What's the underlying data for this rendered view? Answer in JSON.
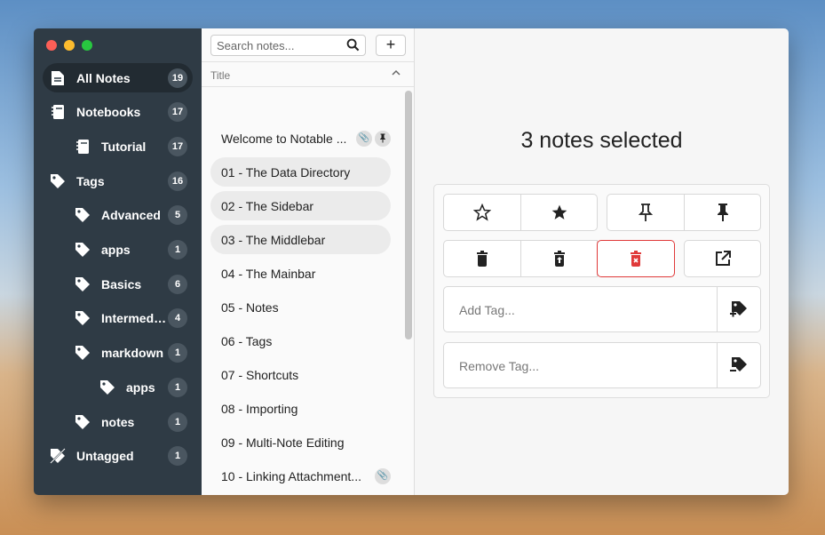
{
  "sidebar": {
    "items": [
      {
        "label": "All Notes",
        "count": "19",
        "icon": "all-notes-icon",
        "level": 0,
        "active": true
      },
      {
        "label": "Notebooks",
        "count": "17",
        "icon": "notebook-icon",
        "level": 0
      },
      {
        "label": "Tutorial",
        "count": "17",
        "icon": "notebook-icon",
        "level": 1
      },
      {
        "label": "Tags",
        "count": "16",
        "icon": "tag-icon",
        "level": 0
      },
      {
        "label": "Advanced",
        "count": "5",
        "icon": "tag-icon",
        "level": 1
      },
      {
        "label": "apps",
        "count": "1",
        "icon": "tag-icon",
        "level": 1
      },
      {
        "label": "Basics",
        "count": "6",
        "icon": "tag-icon",
        "level": 1
      },
      {
        "label": "Intermed…",
        "count": "4",
        "icon": "tag-icon",
        "level": 1
      },
      {
        "label": "markdown",
        "count": "1",
        "icon": "tag-icon",
        "level": 1
      },
      {
        "label": "apps",
        "count": "1",
        "icon": "tag-icon",
        "level": 2
      },
      {
        "label": "notes",
        "count": "1",
        "icon": "tag-icon",
        "level": 1
      },
      {
        "label": "Untagged",
        "count": "1",
        "icon": "untagged-icon",
        "level": 0
      }
    ]
  },
  "middlebar": {
    "search_placeholder": "Search notes...",
    "add_label": "+",
    "column_title": "Title",
    "notes": [
      {
        "title": "Welcome to Notable ...",
        "attachment": true,
        "pinned": true
      },
      {
        "title": "01 - The Data Directory",
        "selected": true
      },
      {
        "title": "02 - The Sidebar",
        "selected": true
      },
      {
        "title": "03 - The Middlebar",
        "selected": true
      },
      {
        "title": "04 - The Mainbar"
      },
      {
        "title": "05 - Notes"
      },
      {
        "title": "06 - Tags"
      },
      {
        "title": "07 - Shortcuts"
      },
      {
        "title": "08 - Importing"
      },
      {
        "title": "09 - Multi-Note Editing"
      },
      {
        "title": "10 - Linking Attachment...",
        "attachment": true
      },
      {
        "title": "11 - Synchronization"
      }
    ]
  },
  "main": {
    "title": "3 notes selected",
    "add_tag_placeholder": "Add Tag...",
    "remove_tag_placeholder": "Remove Tag...",
    "danger_color": "#e03a3a"
  }
}
